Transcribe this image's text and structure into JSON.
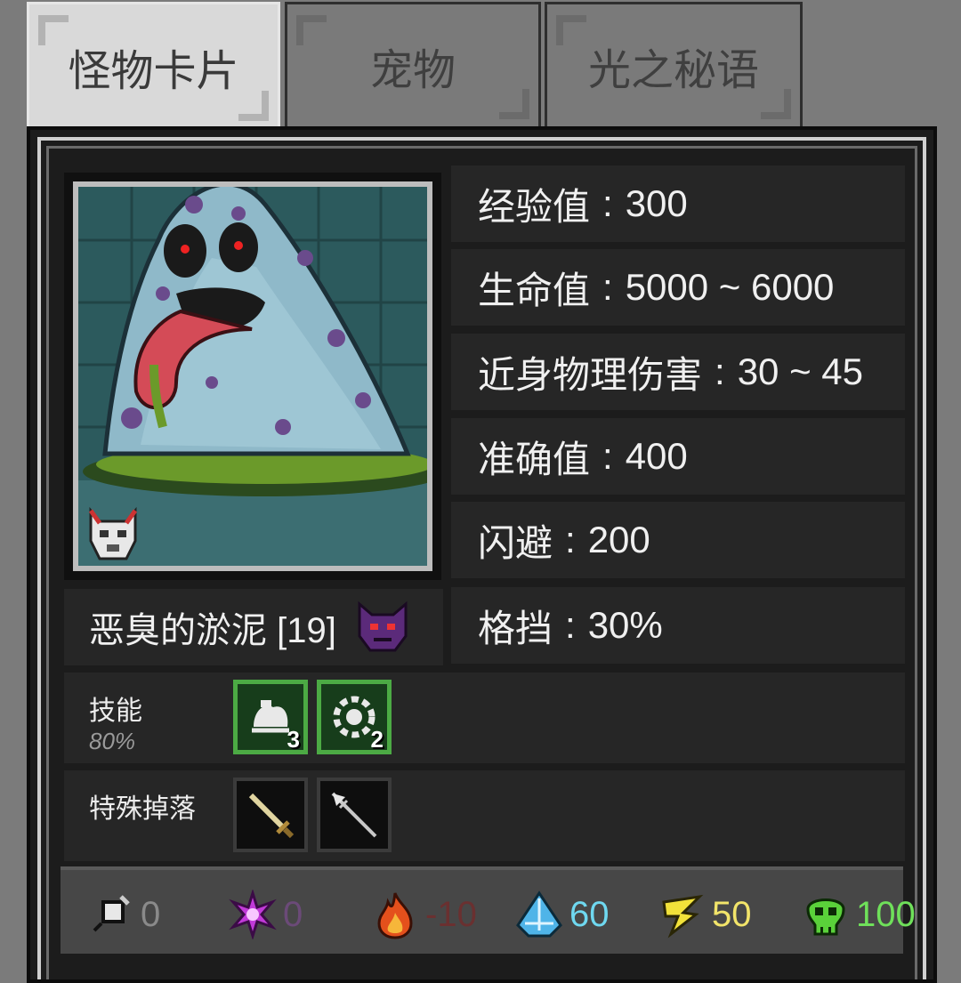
{
  "tabs": [
    {
      "label": "怪物卡片",
      "active": true
    },
    {
      "label": "宠物",
      "active": false
    },
    {
      "label": "光之秘语",
      "active": false
    }
  ],
  "stats": [
    {
      "label": "经验值",
      "value": "300"
    },
    {
      "label": "生命值",
      "value": "5000 ~ 6000"
    },
    {
      "label": "近身物理伤害",
      "value": "30 ~ 45"
    },
    {
      "label": "准确值",
      "value": "400"
    },
    {
      "label": "闪避",
      "value": "200"
    },
    {
      "label": "格挡",
      "value": "30%"
    }
  ],
  "monster": {
    "name": "恶臭的淤泥 [19]"
  },
  "skills": {
    "label": "技能",
    "rate": "80%",
    "items": [
      {
        "icon": "slime-skill-icon",
        "count": "3"
      },
      {
        "icon": "gear-skill-icon",
        "count": "2"
      }
    ]
  },
  "drops": {
    "label": "特殊掉落",
    "items": [
      {
        "icon": "sword-icon"
      },
      {
        "icon": "spear-icon"
      }
    ]
  },
  "resistances": [
    {
      "icon": "physical-icon",
      "value": "0",
      "color": "#8a8a8a"
    },
    {
      "icon": "arcane-icon",
      "value": "0",
      "color": "#6b4a78"
    },
    {
      "icon": "fire-icon",
      "value": "-10",
      "color": "#6a3030"
    },
    {
      "icon": "ice-icon",
      "value": "60",
      "color": "#6fd8f0"
    },
    {
      "icon": "lightning-icon",
      "value": "50",
      "color": "#f2e46a"
    },
    {
      "icon": "poison-icon",
      "value": "100",
      "color": "#6fe05a"
    }
  ]
}
